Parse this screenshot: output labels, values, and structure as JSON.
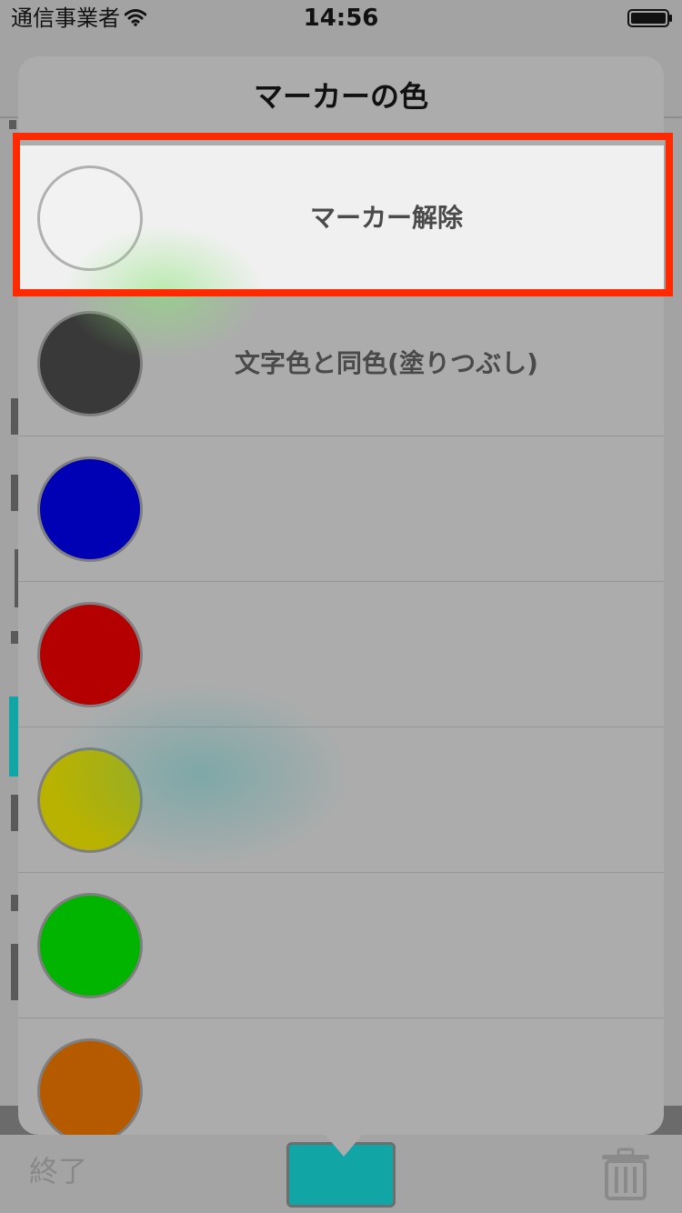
{
  "status_bar": {
    "carrier": "通信事業者",
    "time": "14:56"
  },
  "popover": {
    "title": "マーカーの色",
    "options": [
      {
        "label": "マーカー解除",
        "color": "#f2f2f2",
        "selected": true
      },
      {
        "label": "文字色と同色(塗りつぶし)",
        "color": "#393939",
        "selected": false
      },
      {
        "label": "",
        "color": "#0000b4",
        "selected": false
      },
      {
        "label": "",
        "color": "#b40000",
        "selected": false
      },
      {
        "label": "",
        "color": "#b9b200",
        "selected": false
      },
      {
        "label": "",
        "color": "#00b400",
        "selected": false
      },
      {
        "label": "",
        "color": "#b65a00",
        "selected": false
      }
    ]
  },
  "toolbar": {
    "done_label": "終了",
    "marker_button_color": "#12a5a5",
    "trash_icon": "trash-icon"
  },
  "highlight": {
    "color": "#ff2a00"
  }
}
